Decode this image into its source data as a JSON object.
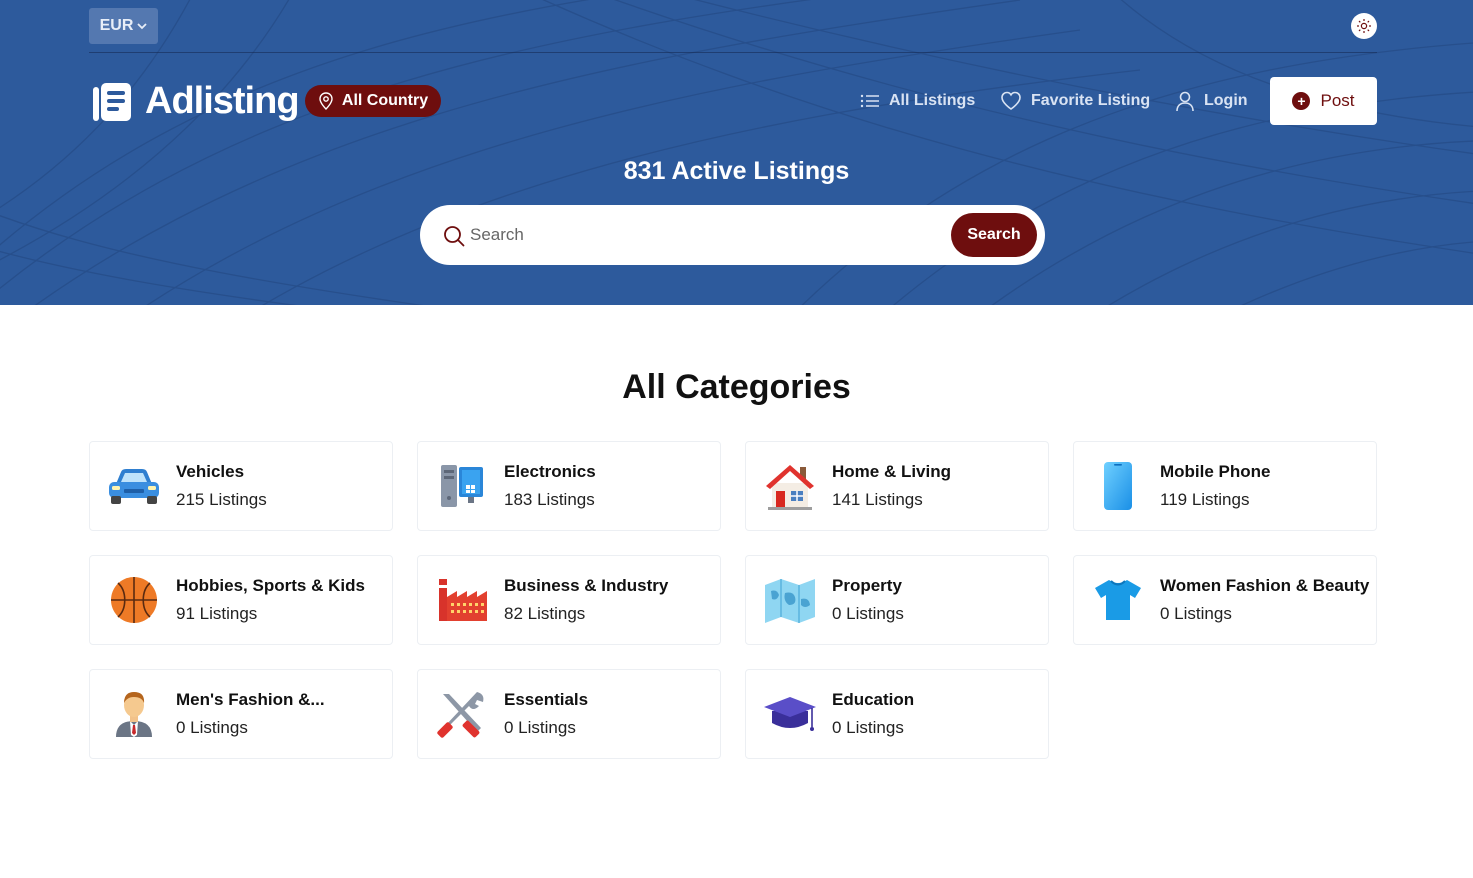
{
  "header": {
    "currency": "EUR",
    "brand": "Adlisting",
    "location_button": "All Country",
    "nav": {
      "all_listings": "All Listings",
      "favorite_listing": "Favorite Listing",
      "login": "Login",
      "post": "Post"
    }
  },
  "hero": {
    "active_listings": "831 Active Listings",
    "search_placeholder": "Search",
    "search_button": "Search"
  },
  "categories_section": {
    "title": "All Categories",
    "items": [
      {
        "name": "Vehicles",
        "count": "215 Listings",
        "icon": "car-icon"
      },
      {
        "name": "Electronics",
        "count": "183 Listings",
        "icon": "computer-icon"
      },
      {
        "name": "Home & Living",
        "count": "141 Listings",
        "icon": "house-icon"
      },
      {
        "name": "Mobile Phone",
        "count": "119 Listings",
        "icon": "mobile-phone-icon"
      },
      {
        "name": "Hobbies, Sports & Kids",
        "count": "91 Listings",
        "icon": "basketball-icon"
      },
      {
        "name": "Business & Industry",
        "count": "82 Listings",
        "icon": "factory-icon"
      },
      {
        "name": "Property",
        "count": "0 Listings",
        "icon": "map-icon"
      },
      {
        "name": "Women Fashion & Beauty",
        "count": "0 Listings",
        "icon": "tshirt-icon"
      },
      {
        "name": "Men's Fashion &...",
        "count": "0 Listings",
        "icon": "businessman-icon"
      },
      {
        "name": "Essentials",
        "count": "0 Listings",
        "icon": "tools-icon"
      },
      {
        "name": "Education",
        "count": "0 Listings",
        "icon": "graduation-cap-icon"
      }
    ]
  },
  "colors": {
    "hero_bg": "#2d5a9c",
    "accent": "#6e0e0e",
    "currency_bg": "#5478b0"
  }
}
